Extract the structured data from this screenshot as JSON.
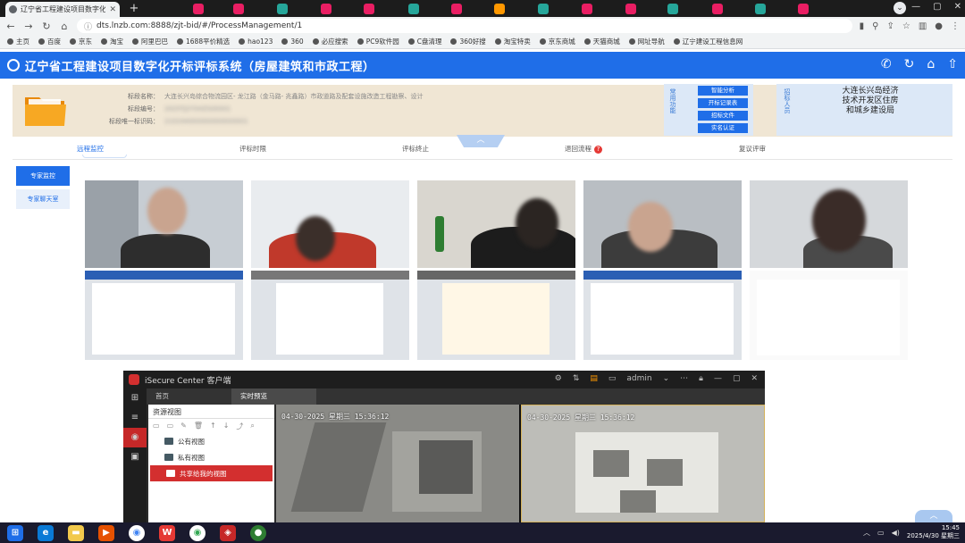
{
  "browser": {
    "tab_title": "辽宁省工程建设项目数字化开标评标",
    "url": "dts.lnzb.com:8888/zjt-bid/#/ProcessManagement/1",
    "bookmarks": [
      "主页",
      "百度",
      "京东",
      "淘宝",
      "阿里巴巴",
      "1688平价精选",
      "hao123",
      "360",
      "必应搜索",
      "PC9软件园",
      "C盘清理",
      "360好搜",
      "淘宝特卖",
      "京东商城",
      "天猫商城",
      "网址导航",
      "辽宁建设工程信息网"
    ]
  },
  "app": {
    "title": "辽宁省工程建设项目数字化开标评标系统（房屋建筑和市政工程）",
    "header_icons": [
      "phone-icon",
      "refresh-icon",
      "home-icon",
      "upload-icon"
    ]
  },
  "project": {
    "rows": [
      {
        "label": "标段名称：",
        "value": "大连长兴岛综合物流园区- 龙江路（金马路- 兆鑫路）市政道路及配套设施改造工程勘察、设计"
      },
      {
        "label": "标段编号：",
        "value": "2025TJ2YSHZS00001"
      },
      {
        "label": "标段唯一标识码：",
        "value": "210244000000000000001"
      }
    ]
  },
  "quick_functions": {
    "section_label": "常用功能",
    "buttons": [
      "智能分析",
      "开标记录表",
      "招标文件",
      "实名认证"
    ]
  },
  "tenderer": {
    "section_label": "招标人员",
    "name": "大连长兴岛经济技术开发区住房和城乡建设局"
  },
  "main_tabs": [
    {
      "label": "远程监控"
    },
    {
      "label": "评标时限"
    },
    {
      "label": "评标终止"
    },
    {
      "label": "退回流程",
      "badge": "?"
    },
    {
      "label": "复议评审"
    }
  ],
  "subnav": [
    "专家监控",
    "专家聊天室"
  ],
  "isecure": {
    "title": "iSecure Center 客户端",
    "user": "admin",
    "tabs": [
      "首页",
      "实时预览"
    ],
    "tree_header": "资源视图",
    "tree_items": [
      "公有视图",
      "私有视图",
      "共享给我的视图"
    ],
    "cam_timestamp_1": "04-30-2025 星期三 15:36:12",
    "cam_timestamp_2": "04-30-2025 星期三 15:36:12"
  },
  "taskbar": {
    "apps": [
      "windows-icon",
      "edge-icon",
      "file-explorer-icon",
      "media-player-icon",
      "chrome-alt-icon",
      "wps-icon",
      "chrome-icon",
      "isecure-icon",
      "wechat-icon"
    ],
    "time": "15:45",
    "date": "2025/4/30 星期三"
  },
  "colors": {
    "brand_blue": "#1f6ee8",
    "info_bg": "#f0e6d4",
    "alert_red": "#d32f2f"
  }
}
